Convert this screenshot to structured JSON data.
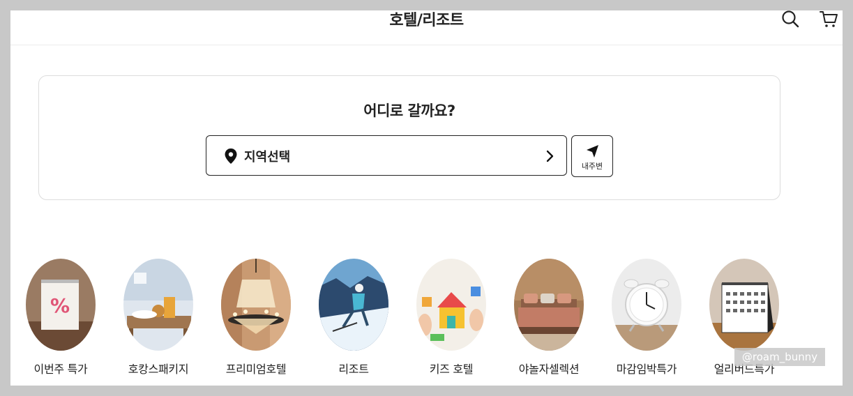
{
  "header": {
    "title": "호텔/리조트",
    "search_icon": "search-icon",
    "cart_icon": "cart-icon"
  },
  "search": {
    "heading": "어디로 갈까요?",
    "region_label": "지역선택",
    "nearby_label": "내주변"
  },
  "categories": [
    {
      "label": "이번주 특가",
      "icon": "percent-calendar-image"
    },
    {
      "label": "호캉스패키지",
      "icon": "breakfast-tray-image"
    },
    {
      "label": "프리미엄호텔",
      "icon": "chandelier-image"
    },
    {
      "label": "리조트",
      "icon": "skier-image"
    },
    {
      "label": "키즈 호텔",
      "icon": "toy-blocks-image"
    },
    {
      "label": "야놀자셀렉션",
      "icon": "bedroom-image"
    },
    {
      "label": "마감임박특가",
      "icon": "alarm-clock-image"
    },
    {
      "label": "얼리버드특가",
      "icon": "desk-calendar-image"
    }
  ],
  "watermark": "@roam_bunny"
}
